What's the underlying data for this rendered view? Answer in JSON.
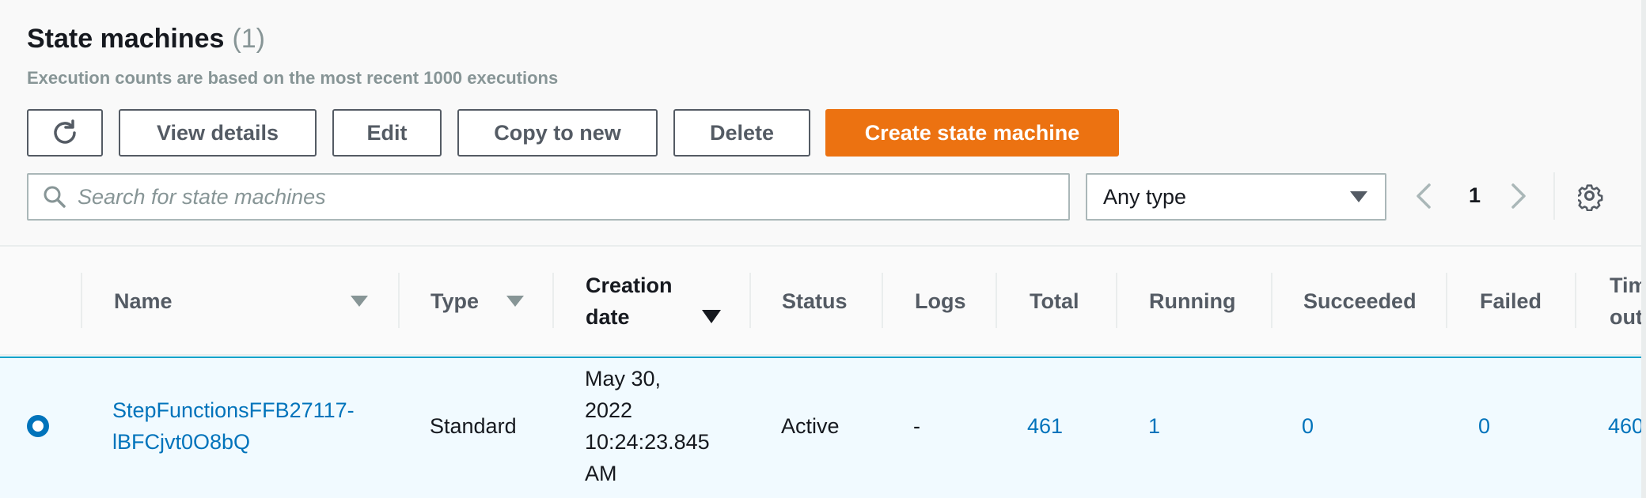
{
  "header": {
    "title": "State machines",
    "count": "(1)",
    "subtitle": "Execution counts are based on the most recent 1000 executions"
  },
  "toolbar": {
    "refresh_icon": "refresh-icon",
    "view_details": "View details",
    "edit": "Edit",
    "copy_to_new": "Copy to new",
    "delete": "Delete",
    "create": "Create state machine",
    "primary_color": "#ec7211"
  },
  "filter": {
    "search_placeholder": "Search for state machines",
    "type_value": "Any type"
  },
  "pagination": {
    "page": "1"
  },
  "table": {
    "headers": {
      "name": "Name",
      "type": "Type",
      "creation_date_line1": "Creation",
      "creation_date_line2": "date",
      "status": "Status",
      "logs": "Logs",
      "total": "Total",
      "running": "Running",
      "succeeded": "Succeeded",
      "failed": "Failed",
      "timed_out_line1": "Tim",
      "timed_out_line2": "out"
    },
    "rows": [
      {
        "selected": true,
        "name_line1": "StepFunctionsFFB27117-",
        "name_line2": "lBFCjvt0O8bQ",
        "type": "Standard",
        "date_line1": "May 30,",
        "date_line2": "2022",
        "date_line3": "10:24:23.845",
        "date_line4": "AM",
        "status": "Active",
        "logs": "-",
        "total": "461",
        "running": "1",
        "succeeded": "0",
        "failed": "0",
        "timed_out": "460"
      }
    ]
  }
}
